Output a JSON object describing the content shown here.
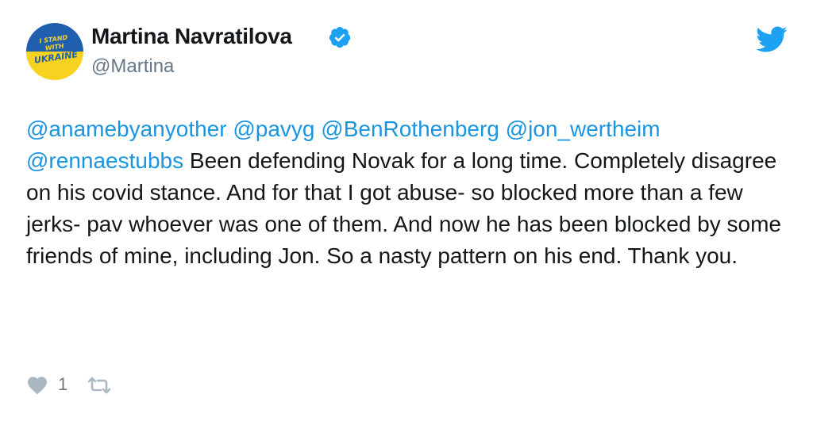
{
  "author": {
    "display_name": "Martina Navratilova",
    "handle": "@Martina",
    "verified": true,
    "avatar": {
      "line1": "I STAND",
      "line2": "WITH",
      "line3": "UKRAINE",
      "colors": {
        "top": "#1f5fae",
        "bottom": "#f7d21e"
      }
    }
  },
  "tweet": {
    "mentions": [
      "@anamebyanyother",
      "@pavyg",
      "@BenRothenberg",
      "@jon_wertheim",
      "@rennaestubbs"
    ],
    "body": "Been defending Novak for a long time. Completely disagree on his covid stance. And for that I got abuse- so blocked more than a few jerks- pav whoever was one of them. And now he has been blocked by some friends of mine, including Jon. So a nasty pattern on his end. Thank you."
  },
  "actions": {
    "like_icon": "heart-icon",
    "like_count": "1",
    "retweet_icon": "retweet-icon"
  },
  "brand": {
    "icon": "twitter-bird-icon",
    "accent_color": "#1da1f2",
    "mention_color": "#1b95e0",
    "secondary_text_color": "#657786"
  }
}
